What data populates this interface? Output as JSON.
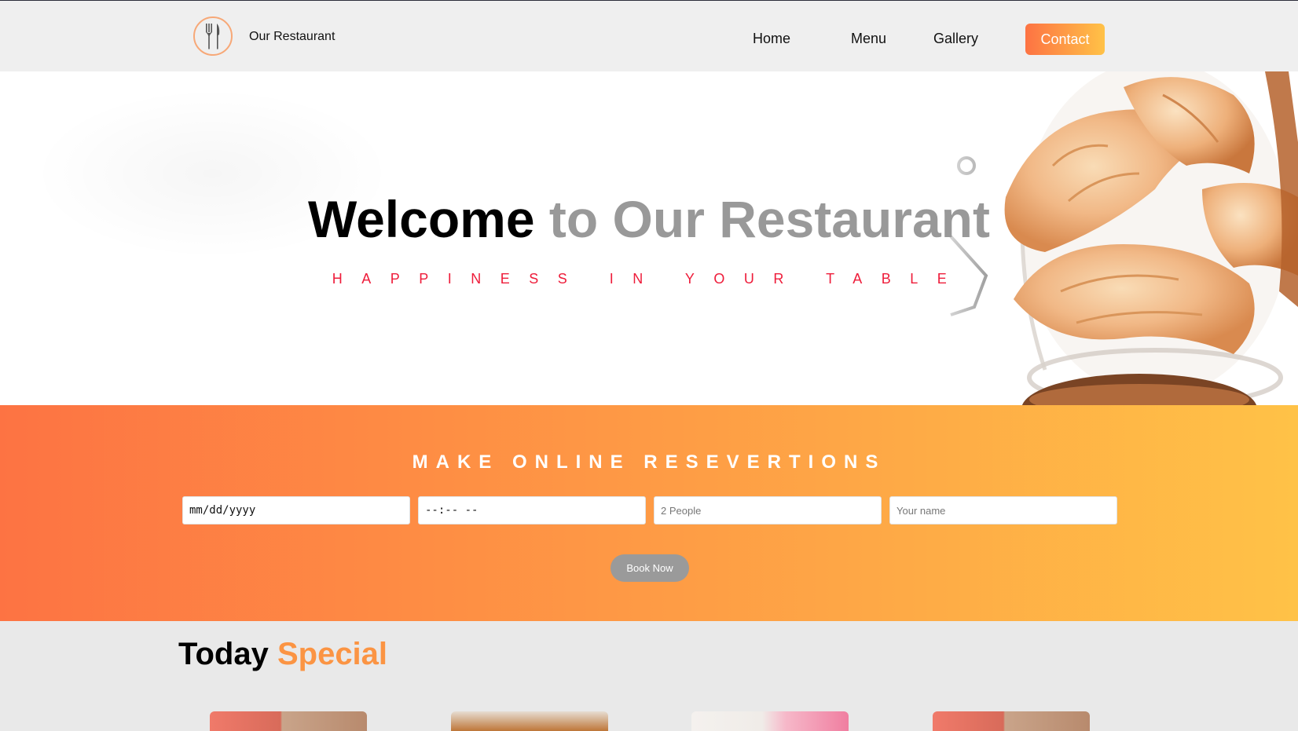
{
  "header": {
    "brand": "Our Restaurant",
    "logo_icon": "fork-knife-icon",
    "nav": {
      "home": "Home",
      "menu": "Menu",
      "gallery": "Gallery",
      "contact": "Contact"
    }
  },
  "hero": {
    "title_word1": "Welcome",
    "title_rest": "to Our Restaurant",
    "subtitle": "HAPPINESS IN YOUR TABLE"
  },
  "reservation": {
    "title": "MAKE ONLINE RESEVERTIONS",
    "date_placeholder": "mm/dd/yyyy",
    "time_placeholder": "--:-- --",
    "people_placeholder": "2 People",
    "name_placeholder": "Your name",
    "book_label": "Book Now"
  },
  "special": {
    "title_word1": "Today",
    "title_word2": "Special"
  },
  "colors": {
    "accent_start": "#fd7343",
    "accent_end": "#ffc247",
    "subtitle_red": "#ee1c3a",
    "special_orange": "#fb9443"
  }
}
